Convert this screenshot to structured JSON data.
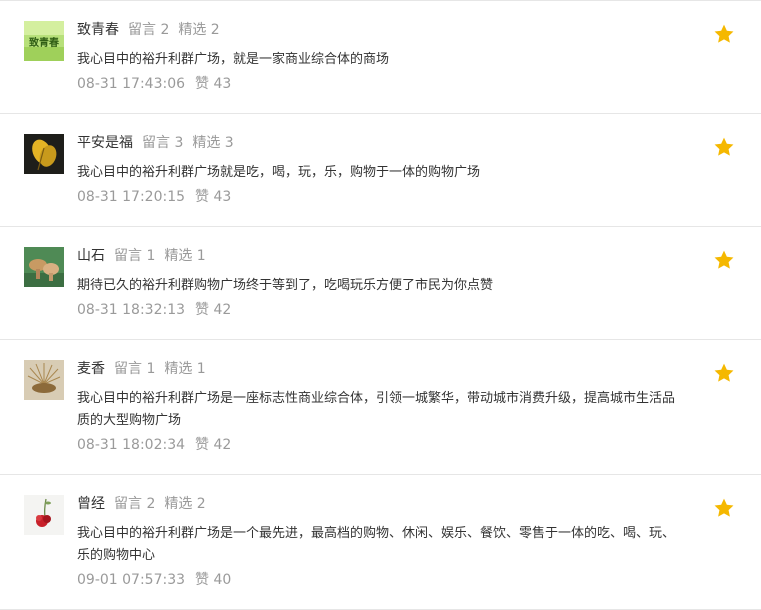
{
  "comments": [
    {
      "nickname": "致青春",
      "reply_count": "留言 2",
      "featured_count": "精选 2",
      "text": "我心目中的裕升利群广场，就是一家商业综合体的商场",
      "time": "08-31 17:43:06",
      "likes": "赞 43",
      "avatar_text": "致青春"
    },
    {
      "nickname": "平安是福",
      "reply_count": "留言 3",
      "featured_count": "精选 3",
      "text": "我心目中的裕升利群广场就是吃，喝，玩，乐，购物于一体的购物广场",
      "time": "08-31 17:20:15",
      "likes": "赞 43"
    },
    {
      "nickname": "山石",
      "reply_count": "留言 1",
      "featured_count": "精选 1",
      "text": "期待已久的裕升利群购物广场终于等到了，吃喝玩乐方便了市民为你点赞",
      "time": "08-31 18:32:13",
      "likes": "赞 42"
    },
    {
      "nickname": "麦香",
      "reply_count": "留言 1",
      "featured_count": "精选 1",
      "text": "我心目中的裕升利群广场是一座标志性商业综合体，引领一城繁华，带动城市消费升级，提高城市生活品质的大型购物广场",
      "time": "08-31 18:02:34",
      "likes": "赞 42"
    },
    {
      "nickname": "曾经",
      "reply_count": "留言 2",
      "featured_count": "精选 2",
      "text": "我心目中的裕升利群广场是一个最先进，最高档的购物、休闲、娱乐、餐饮、零售于一体的吃、喝、玩、乐的购物中心",
      "time": "09-01 07:57:33",
      "likes": "赞 40"
    }
  ],
  "colors": {
    "star": "#f5b800",
    "muted_text": "#999999",
    "body_text": "#333333",
    "divider": "#e6e6e6"
  },
  "icons": {
    "star": "star-icon"
  }
}
